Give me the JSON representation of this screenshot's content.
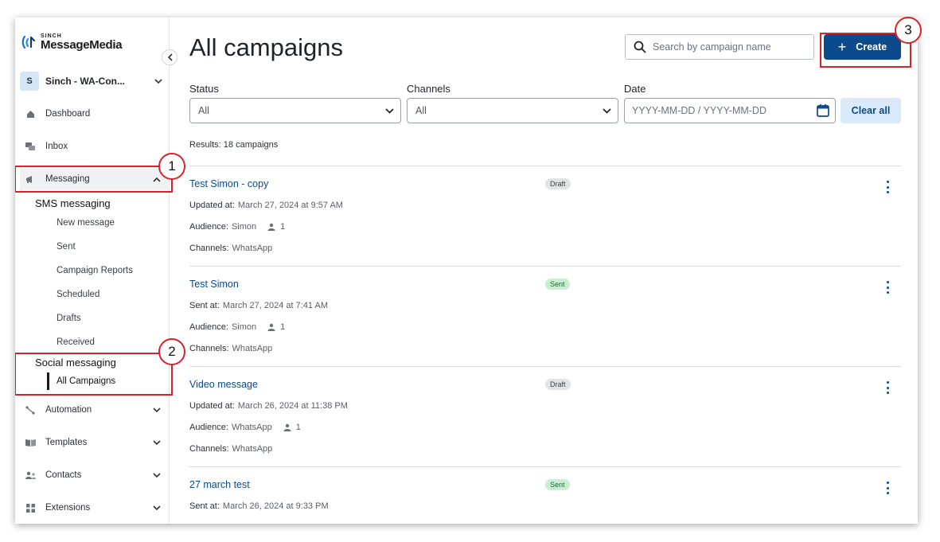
{
  "brand": {
    "top": "SINCH",
    "name": "MessageMedia"
  },
  "account": {
    "initial": "S",
    "name": "Sinch - WA-Con..."
  },
  "sidebar": {
    "items": [
      {
        "label": "Dashboard"
      },
      {
        "label": "Inbox"
      },
      {
        "label": "Messaging"
      },
      {
        "label": "Automation"
      },
      {
        "label": "Templates"
      },
      {
        "label": "Contacts"
      },
      {
        "label": "Extensions"
      }
    ],
    "sms_heading": "SMS messaging",
    "sms_items": [
      "New message",
      "Sent",
      "Campaign Reports",
      "Scheduled",
      "Drafts",
      "Received"
    ],
    "social_heading": "Social messaging",
    "social_active": "All Campaigns"
  },
  "annotations": [
    "1",
    "2",
    "3"
  ],
  "header": {
    "title": "All campaigns",
    "search_placeholder": "Search by campaign name",
    "create_label": "Create"
  },
  "filters": {
    "status_label": "Status",
    "status_value": "All",
    "channels_label": "Channels",
    "channels_value": "All",
    "date_label": "Date",
    "date_placeholder": "YYYY-MM-DD / YYYY-MM-DD",
    "clear_label": "Clear all"
  },
  "results_text": "Results: 18 campaigns",
  "campaigns": [
    {
      "title": "Test Simon - copy",
      "status": "Draft",
      "time_key": "Updated at:",
      "time_val": "March 27, 2024 at 9:57 AM",
      "audience_key": "Audience:",
      "audience_val": "Simon",
      "audience_count": "1",
      "channels_key": "Channels:",
      "channels_val": "WhatsApp"
    },
    {
      "title": "Test Simon",
      "status": "Sent",
      "time_key": "Sent at:",
      "time_val": "March 27, 2024 at 7:41 AM",
      "audience_key": "Audience:",
      "audience_val": "Simon",
      "audience_count": "1",
      "channels_key": "Channels:",
      "channels_val": "WhatsApp"
    },
    {
      "title": "Video message",
      "status": "Draft",
      "time_key": "Updated at:",
      "time_val": "March 26, 2024 at 11:38 PM",
      "audience_key": "Audience:",
      "audience_val": "WhatsApp",
      "audience_count": "1",
      "channels_key": "Channels:",
      "channels_val": "WhatsApp"
    },
    {
      "title": "27 march test",
      "status": "Sent",
      "time_key": "Sent at:",
      "time_val": "March 26, 2024 at 9:33 PM"
    }
  ],
  "colors": {
    "accent": "#0b4a8c",
    "annotation": "#d8232a",
    "sent_badge": "#c9efd3",
    "draft_badge": "#e3e4e6"
  }
}
